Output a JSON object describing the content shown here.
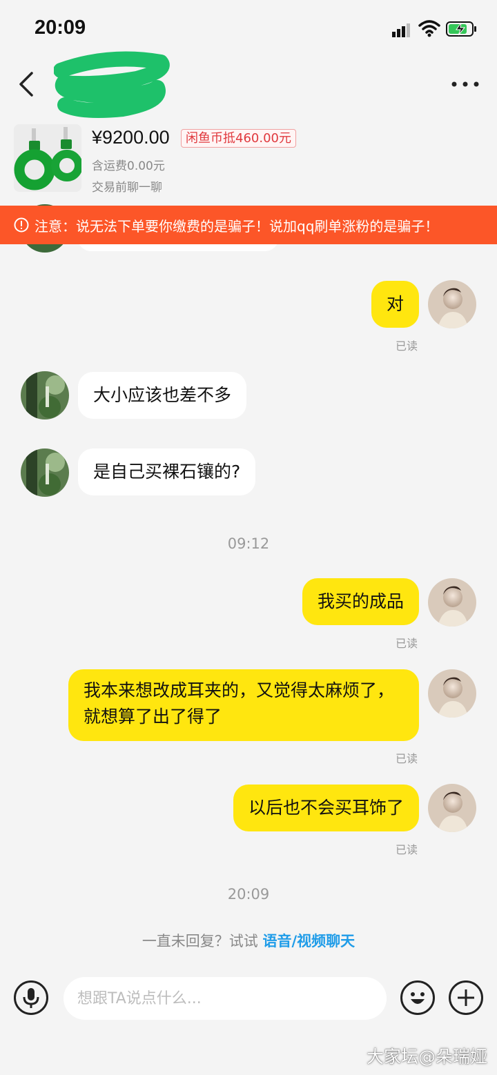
{
  "status_bar": {
    "time": "20:09"
  },
  "header": {
    "more_icon": "more-dots-icon",
    "back_icon": "chevron-left-icon"
  },
  "product": {
    "price": "¥9200.00",
    "coin_badge": "闲鱼币抵460.00元",
    "shipping": "含运费0.00元",
    "subtitle": "交易前聊一聊"
  },
  "warning": {
    "text": "注意：说无法下单要你缴费的是骗子！说加qq刷单涨粉的是骗子！",
    "color": "#fc5628"
  },
  "messages": [
    {
      "side": "out",
      "text": "对",
      "status": "已读"
    },
    {
      "side": "in",
      "text": "大小应该也差不多"
    },
    {
      "side": "in",
      "text": "是自己买裸石镶的?"
    },
    {
      "type": "time",
      "text": "09:12"
    },
    {
      "side": "out",
      "text": "我买的成品",
      "status": "已读"
    },
    {
      "side": "out",
      "text": "我本来想改成耳夹的，又觉得太麻烦了，就想算了出了得了",
      "status": "已读"
    },
    {
      "side": "out",
      "text": "以后也不会买耳饰了",
      "status": "已读"
    },
    {
      "type": "time",
      "text": "20:09"
    }
  ],
  "hint": {
    "prefix": "一直未回复？试试 ",
    "link": "语音/视频聊天"
  },
  "input_bar": {
    "placeholder": "想跟TA说点什么...",
    "mic_icon": "microphone-icon",
    "emoji_icon": "emoji-icon",
    "plus_icon": "plus-icon"
  },
  "watermark": "大家坛@朵瑞娅",
  "colors": {
    "own_bubble": "#ffe60f",
    "link": "#1f9ce8",
    "background": "#f4f4f4"
  }
}
